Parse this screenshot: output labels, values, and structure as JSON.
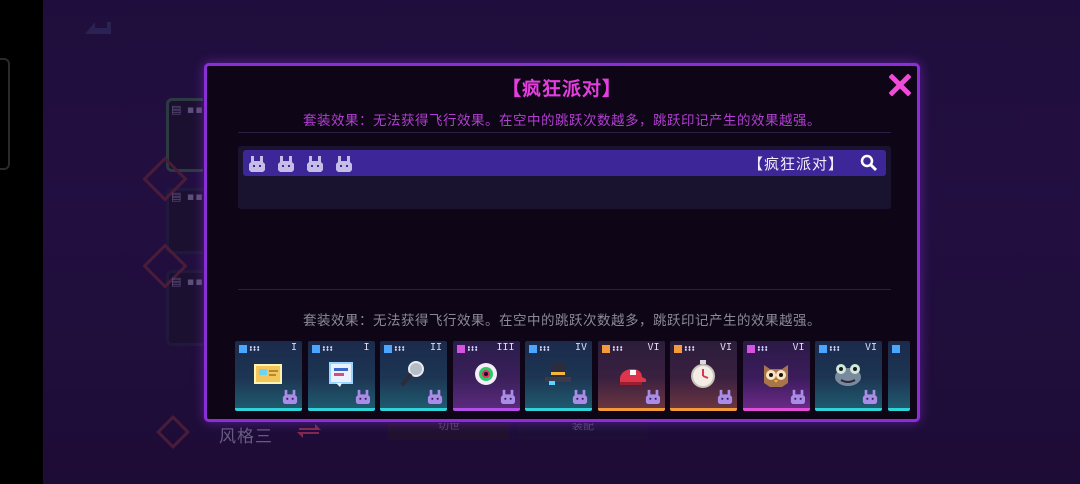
{
  "background": {
    "style_label": "风格三",
    "tab_left": "切世",
    "tab_right": "装配"
  },
  "dialog": {
    "title": "【疯狂派对】",
    "set_effect_text": "套装效果：无法获得飞行效果。在空中的跳跃次数越多，跳跃印记产生的效果越强。",
    "set_row": {
      "name": "【疯狂派对】",
      "rabbit_count": 4,
      "search_icon": "search-icon"
    },
    "set_effect_detail": "套装效果：无法获得飞行效果。在空中的跳跃次数越多，跳跃印记产生的效果越强。",
    "items": [
      {
        "tier": "I",
        "grade_color": "#4aa6ff",
        "edge": "cyan",
        "art": "card"
      },
      {
        "tier": "I",
        "grade_color": "#4aa6ff",
        "edge": "cyan",
        "art": "note"
      },
      {
        "tier": "II",
        "grade_color": "#4aa6ff",
        "edge": "cyan",
        "art": "mic"
      },
      {
        "tier": "III",
        "grade_color": "#d453e0",
        "edge": "purple",
        "art": "eye"
      },
      {
        "tier": "IV",
        "grade_color": "#4aa6ff",
        "edge": "cyan",
        "art": "hat"
      },
      {
        "tier": "VI",
        "grade_color": "#f39a3a",
        "edge": "orange",
        "art": "cap"
      },
      {
        "tier": "VI",
        "grade_color": "#f39a3a",
        "edge": "orange",
        "art": "watch"
      },
      {
        "tier": "VI",
        "grade_color": "#d453e0",
        "edge": "magenta",
        "art": "owl"
      },
      {
        "tier": "VI",
        "grade_color": "#4aa6ff",
        "edge": "cyan",
        "art": "frog"
      }
    ]
  },
  "colors": {
    "accent_magenta": "#e53ee0",
    "panel_border": "#8a2fd6",
    "set_row_bg": "#3d2798"
  }
}
